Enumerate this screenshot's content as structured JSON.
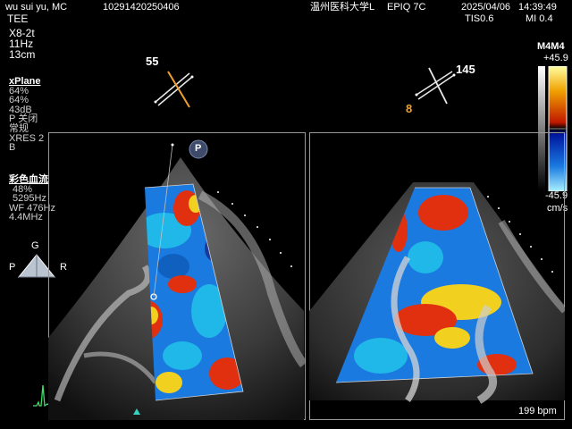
{
  "header": {
    "patient": "wu sui yu, MC",
    "id": "10291420250406",
    "hospital": "温州医科大学L",
    "system": "EPIQ 7C",
    "date": "2025/04/06",
    "time": "14:39:49",
    "tis": "TIS0.6",
    "mi": "MI 0.4"
  },
  "params": {
    "mode": "TEE",
    "probe": "X8-2t",
    "frequency": "11Hz",
    "depth": "13cm",
    "xplane_title": "xPlane",
    "xplane_lines": [
      "64%",
      "64%",
      "43dB",
      "P 关闭",
      "常规",
      "XRES 2",
      "B"
    ],
    "color_title": "彩色血流",
    "color_lines": [
      "48%",
      "5295Hz",
      "WF 476Hz",
      "4.4MHz"
    ]
  },
  "orientation": {
    "g": "G",
    "p": "P",
    "r": "R",
    "pin": "P"
  },
  "angles": {
    "left": "55",
    "right": "145",
    "right_secondary": "8"
  },
  "colorbar": {
    "title": "M4M4",
    "max": "+45.9",
    "min": "-45.9",
    "unit": "cm/s"
  },
  "heart_rate": "199 bpm",
  "colors": {
    "flow_red": "#e03010",
    "flow_yellow": "#f2d020",
    "flow_blue": "#1a7ae0",
    "flow_cyan": "#20b8e8",
    "accent": "#f0a030"
  }
}
